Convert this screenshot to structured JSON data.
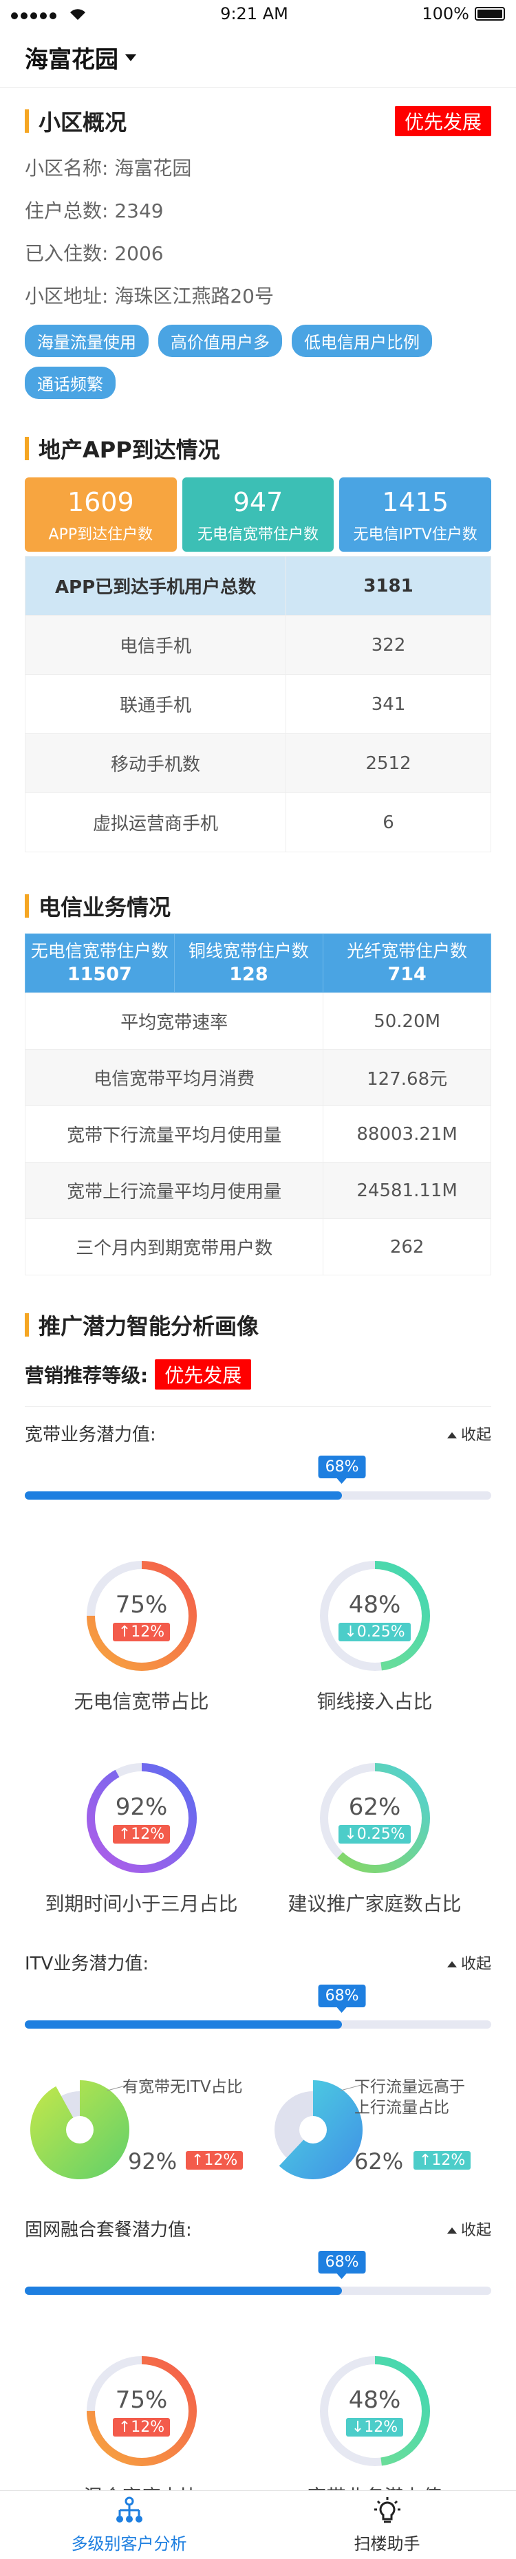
{
  "status_bar": {
    "time": "9:21 AM",
    "battery": "100%"
  },
  "nav": {
    "title": "海富花园"
  },
  "overview": {
    "title": "小区概况",
    "badge": "优先发展",
    "rows": [
      {
        "label": "小区名称:",
        "value": "海富花园"
      },
      {
        "label": "住户总数:",
        "value": "2349"
      },
      {
        "label": "已入住数:",
        "value": "2006"
      },
      {
        "label": "小区地址:",
        "value": "海珠区江燕路20号"
      }
    ],
    "tags": [
      "海量流量使用",
      "高价值用户多",
      "低电信用户比例",
      "通话频繁"
    ]
  },
  "app_reach": {
    "title": "地产APP到达情况",
    "cards": [
      {
        "value": "1609",
        "label": "APP到达住户数",
        "color": "#f7a540"
      },
      {
        "value": "947",
        "label": "无电信宽带住户数",
        "color": "#3cbfb5"
      },
      {
        "value": "1415",
        "label": "无电信IPTV住户数",
        "color": "#4aa4e3"
      }
    ],
    "table": [
      [
        "APP已到达手机用户总数",
        "3181"
      ],
      [
        "电信手机",
        "322"
      ],
      [
        "联通手机",
        "341"
      ],
      [
        "移动手机数",
        "2512"
      ],
      [
        "虚拟运营商手机",
        "6"
      ]
    ]
  },
  "telecom": {
    "title": "电信业务情况",
    "head": [
      {
        "label": "无电信宽带住户数",
        "value": "11507"
      },
      {
        "label": "铜线宽带住户数",
        "value": "128"
      },
      {
        "label": "光纤宽带住户数",
        "value": "714"
      }
    ],
    "rows": [
      [
        "平均宽带速率",
        "50.20M"
      ],
      [
        "电信宽带平均月消费",
        "127.68元"
      ],
      [
        "宽带下行流量平均月使用量",
        "88003.21M"
      ],
      [
        "宽带上行流量平均月使用量",
        "24581.11M"
      ],
      [
        "三个月内到期宽带用户数",
        "262"
      ]
    ]
  },
  "potential": {
    "title": "推广潜力智能分析画像",
    "level_label": "营销推荐等级:",
    "level_value": "优先发展",
    "broadband": {
      "label": "宽带业务潜力值:",
      "collapse": "收起",
      "progress": "68%",
      "progress_value": 0.68,
      "rings": [
        {
          "pct": "75%",
          "value": 0.75,
          "change": "↑12%",
          "dir": "up",
          "caption": "无电信宽带占比",
          "c1": "#f35b4b",
          "c2": "#f7a540"
        },
        {
          "pct": "48%",
          "value": 0.48,
          "change": "↓0.25%",
          "dir": "down",
          "caption": "铜线接入占比",
          "c1": "#3fd6b4",
          "c2": "#7be08f"
        },
        {
          "pct": "92%",
          "value": 0.92,
          "change": "↑12%",
          "dir": "up",
          "caption": "到期时间小于三月占比",
          "c1": "#5b6cf0",
          "c2": "#b25de8"
        },
        {
          "pct": "62%",
          "value": 0.62,
          "change": "↓0.25%",
          "dir": "down",
          "caption": "建议推广家庭数占比",
          "c1": "#4fd0d8",
          "c2": "#8bd85a"
        }
      ]
    },
    "itv": {
      "label": "ITV业务潜力值:",
      "collapse": "收起",
      "progress": "68%",
      "progress_value": 0.68,
      "pies": [
        {
          "note": "有宽带无ITV占比",
          "pct": "92%",
          "value": 0.92,
          "change": "↑12%",
          "dir": "up",
          "c1": "#c6e84a",
          "c2": "#5fcf6a"
        },
        {
          "note": "下行流量远高于上行流量占比",
          "pct": "62%",
          "value": 0.62,
          "change": "↑12%",
          "dir": "down",
          "c1": "#4fd6e0",
          "c2": "#3f8fe6"
        }
      ]
    },
    "fixed": {
      "label": "固网融合套餐潜力值:",
      "collapse": "收起",
      "progress": "68%",
      "progress_value": 0.68,
      "rings": [
        {
          "pct": "75%",
          "value": 0.75,
          "change": "↑12%",
          "dir": "up",
          "caption": "混合家庭占比",
          "c1": "#f35b4b",
          "c2": "#f7a540"
        },
        {
          "pct": "48%",
          "value": 0.48,
          "change": "↓12%",
          "dir": "down",
          "caption": "宽带业务潜力值",
          "c1": "#3fd6b4",
          "c2": "#7be08f"
        }
      ]
    }
  },
  "tabbar": [
    {
      "label": "多级别客户分析",
      "icon": "hierarchy-icon",
      "active": true
    },
    {
      "label": "扫楼助手",
      "icon": "lightbulb-icon",
      "active": false
    }
  ]
}
